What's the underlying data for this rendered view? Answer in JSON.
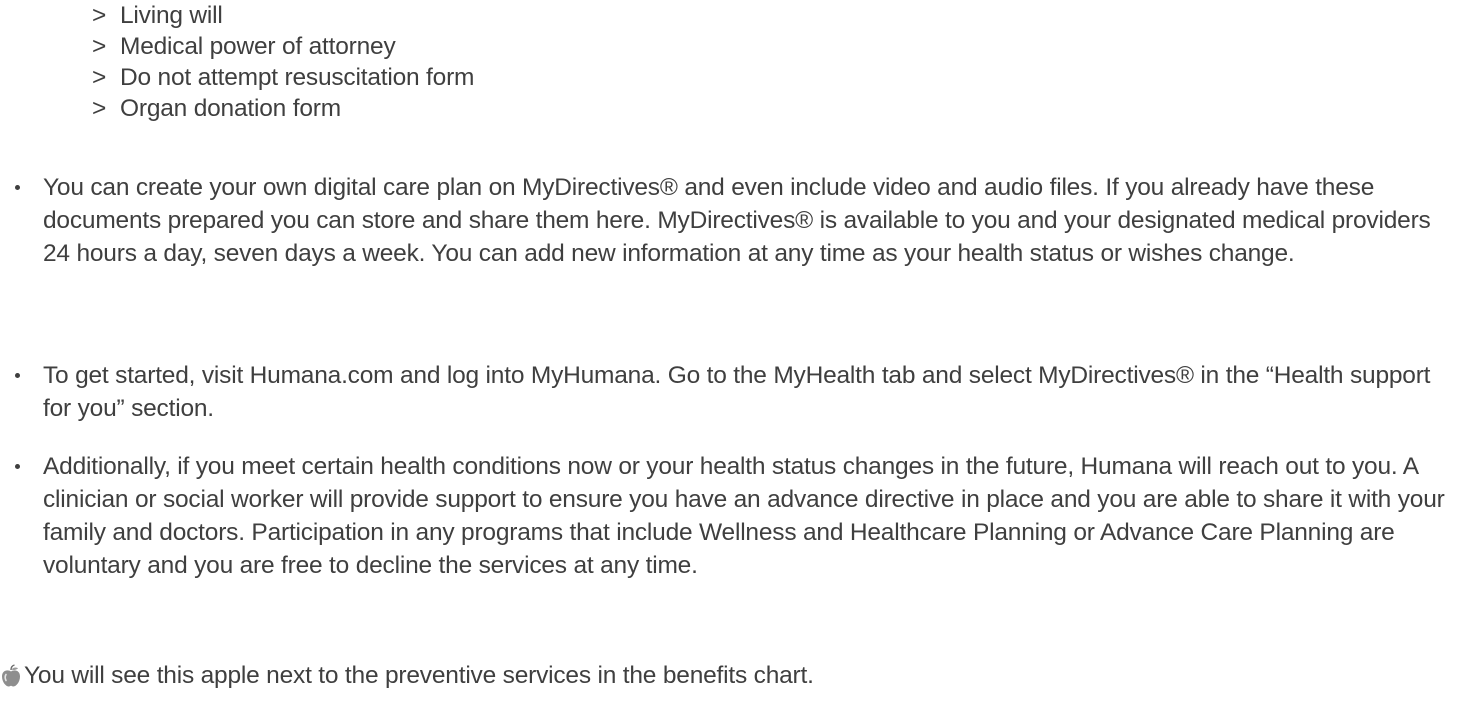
{
  "sublist": {
    "arrow": ">",
    "items": [
      "Living will",
      "Medical power of attorney",
      "Do not attempt resuscitation form",
      "Organ donation form"
    ]
  },
  "bullets": [
    "You can create your own digital care plan on MyDirectives® and even include video and audio files. If you already have these documents prepared you can store and share them here. MyDirectives® is available to you and your designated medical providers 24 hours a day, seven days a week. You can add new information at any time as your health status or wishes change.",
    "To get started, visit Humana.com and log into MyHumana. Go to the MyHealth tab and select MyDirectives® in the “Health support for you” section.",
    "Additionally, if you meet certain health conditions now or your health status changes in the future, Humana will reach out to you. A clinician or social worker will provide support to ensure you have an advance directive in place and you are able to share it with your family and doctors. Participation in any programs that include Wellness and Healthcare Planning or Advance Care Planning are voluntary and you are free to decline the services at any time."
  ],
  "footnote": {
    "icon": "apple-icon",
    "text": "You will see this apple next to the preventive services in the benefits chart."
  }
}
